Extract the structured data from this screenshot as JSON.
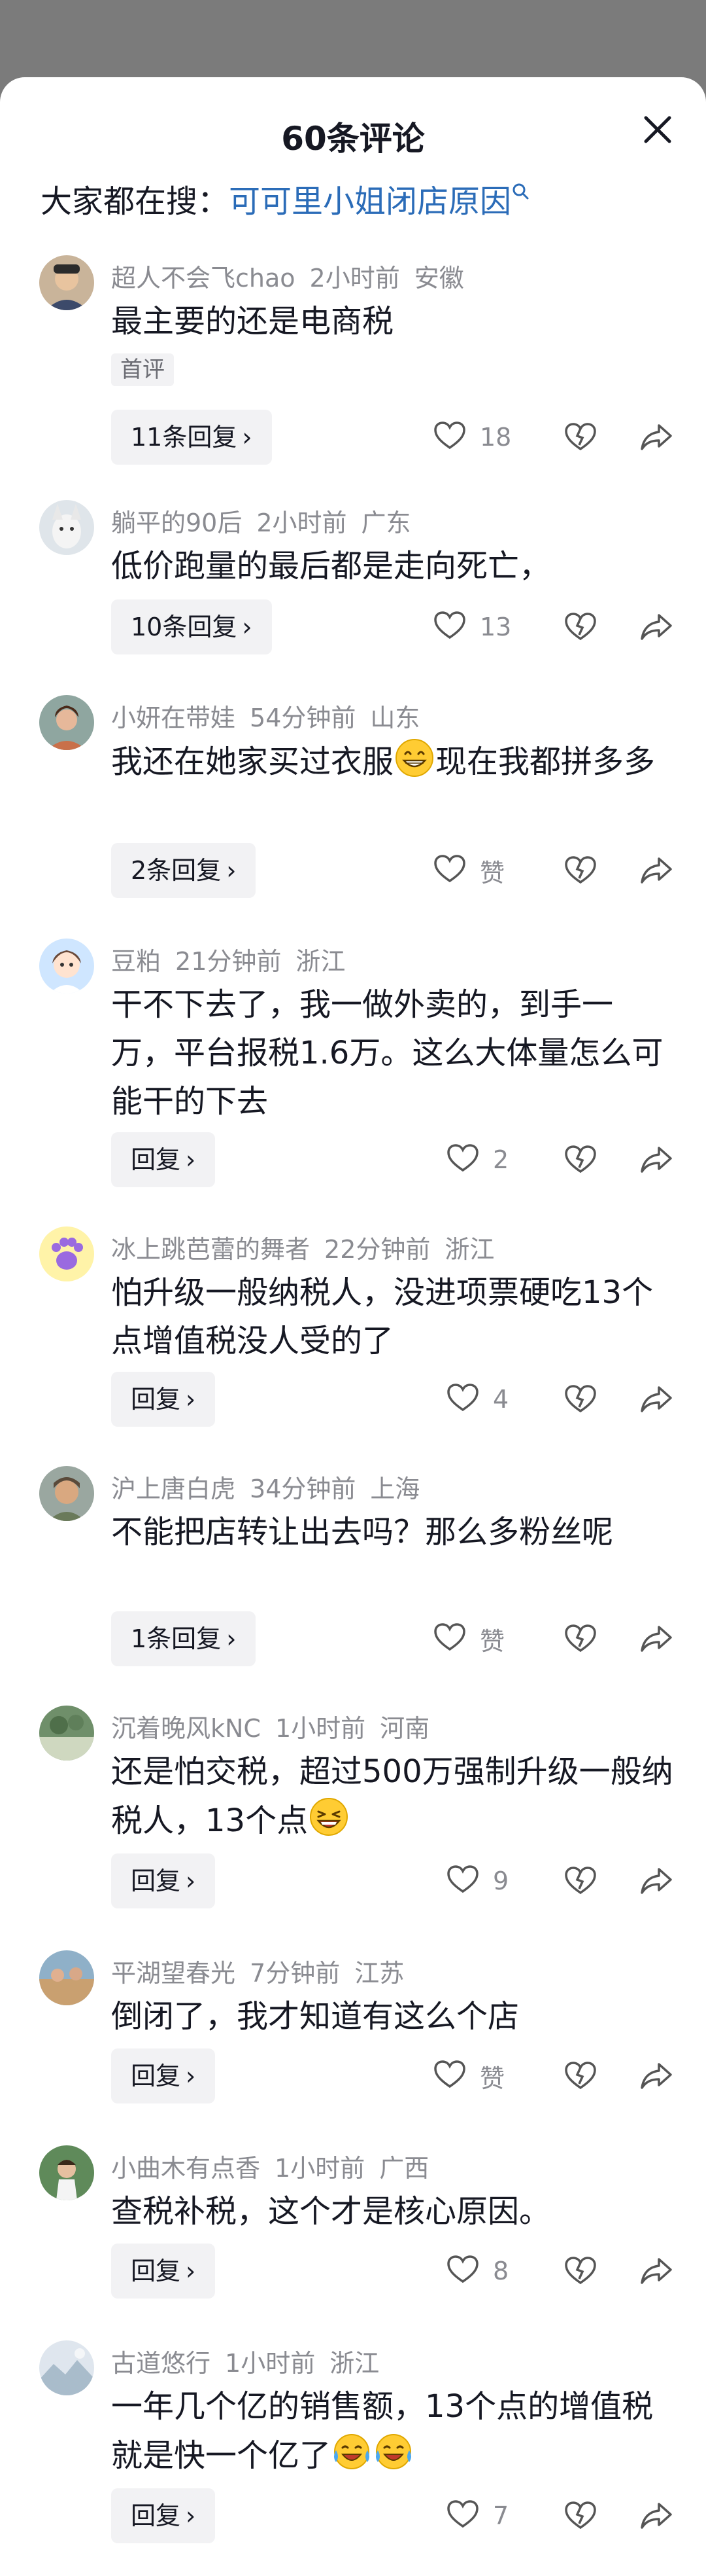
{
  "header": {
    "title": "60条评论",
    "search_prefix": "大家都在搜：",
    "search_keyword": "可可里小姐闭店原因"
  },
  "colors": {
    "link_blue": "#2b6cb8",
    "text_primary": "#161823",
    "text_secondary": "#8a8b91",
    "chip_bg": "#f2f2f4"
  },
  "comments": [
    {
      "user": "超人不会飞chao",
      "time": "2小时前",
      "location": "安徽",
      "text": "最主要的还是电商税",
      "tag": "首评",
      "reply_label": "11条回复",
      "likes": "18"
    },
    {
      "user": "躺平的90后",
      "time": "2小时前",
      "location": "广东",
      "text": "低价跑量的最后都是走向死亡，",
      "reply_label": "10条回复",
      "likes": "13"
    },
    {
      "user": "小妍在带娃",
      "time": "54分钟前",
      "location": "山东",
      "text": "我还在她家买过衣服",
      "text_after_emoji": "现在我都拼多多",
      "emoji": "grin-emoji",
      "reply_label": "2条回复",
      "likes": "赞"
    },
    {
      "user": "豆粕",
      "time": "21分钟前",
      "location": "浙江",
      "text": "干不下去了，我一做外卖的，到手一万，平台报税1.6万。这么大体量怎么可能干的下去",
      "reply_label": "回复",
      "likes": "2"
    },
    {
      "user": "冰上跳芭蕾的舞者",
      "time": "22分钟前",
      "location": "浙江",
      "text": "怕升级一般纳税人，没进项票硬吃13个点增值税没人受的了",
      "reply_label": "回复",
      "likes": "4"
    },
    {
      "user": "沪上唐白虎",
      "time": "34分钟前",
      "location": "上海",
      "text": "不能把店转让出去吗？那么多粉丝呢",
      "reply_label": "1条回复",
      "likes": "赞"
    },
    {
      "user": "沉着晚风kNC",
      "time": "1小时前",
      "location": "河南",
      "text": "还是怕交税，超过500万强制升级一般纳税人，13个点",
      "emoji": "laugh-emoji",
      "reply_label": "回复",
      "likes": "9"
    },
    {
      "user": "平湖望春光",
      "time": "7分钟前",
      "location": "江苏",
      "text": "倒闭了，我才知道有这么个店",
      "reply_label": "回复",
      "likes": "赞"
    },
    {
      "user": "小曲木有点香",
      "time": "1小时前",
      "location": "广西",
      "text": "查税补税，这个才是核心原因。",
      "reply_label": "回复",
      "likes": "8"
    },
    {
      "user": "古道悠行",
      "time": "1小时前",
      "location": "浙江",
      "text": "一年几个亿的销售额，13个点的增值税就是快一个亿了",
      "emoji": "crying-laugh-emoji",
      "emoji_count": 2,
      "reply_label": "回复",
      "likes": "7"
    }
  ]
}
